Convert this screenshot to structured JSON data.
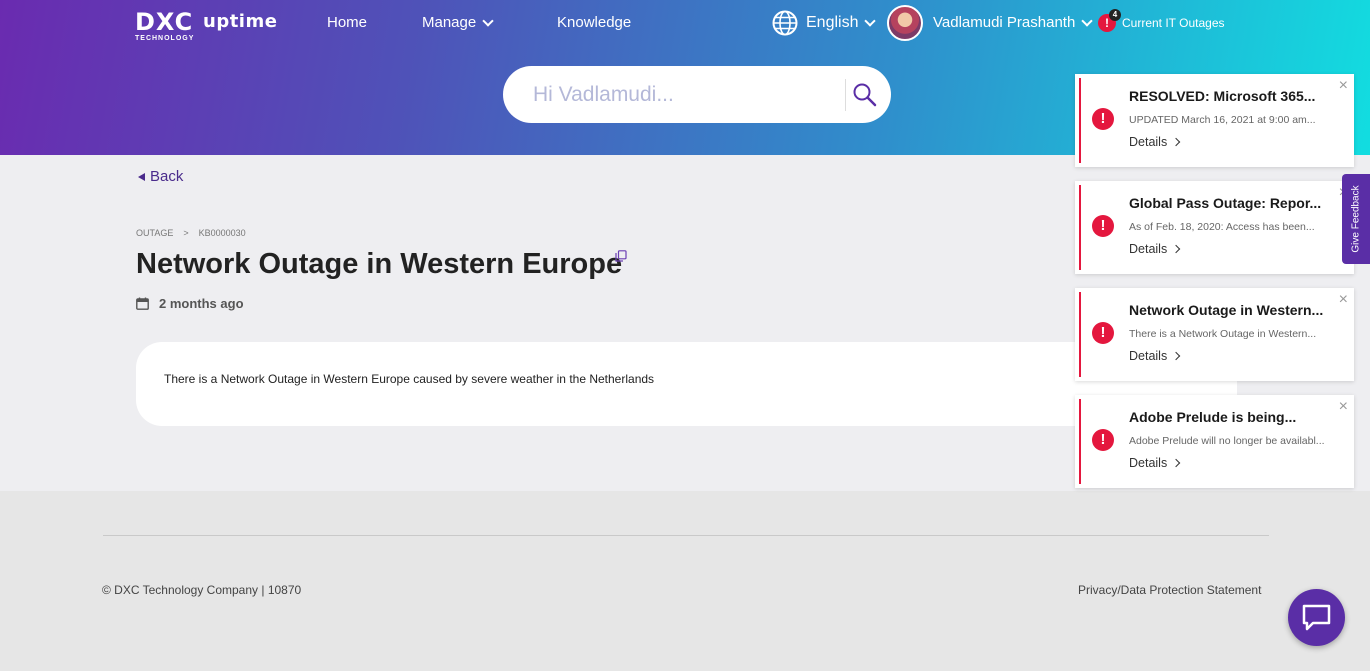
{
  "header": {
    "logo_main": "DXC",
    "logo_sub": "TECHNOLOGY",
    "product": "uptime",
    "nav": {
      "home": "Home",
      "manage": "Manage",
      "knowledge": "Knowledge"
    },
    "language": "English",
    "user_name": "Vadlamudi Prashanth",
    "outage_count": "4",
    "outage_alert_symbol": "!",
    "outage_link": "Current IT Outages"
  },
  "search": {
    "placeholder": "Hi Vadlamudi..."
  },
  "article": {
    "back_label": "Back",
    "breadcrumb": [
      "OUTAGE",
      ">",
      "KB0000030"
    ],
    "title": "Network Outage in Western Europe",
    "date": "2 months ago",
    "body": "There is a Network Outage in Western Europe caused by severe weather in the Netherlands"
  },
  "notifications": [
    {
      "title": "RESOLVED: Microsoft 365...",
      "body": "UPDATED March 16, 2021 at 9:00 am...",
      "details": "Details"
    },
    {
      "title": "Global Pass Outage: Repor...",
      "body": "As of Feb. 18, 2020: Access has been...",
      "details": "Details"
    },
    {
      "title": "Network Outage in Western...",
      "body": "There is a Network Outage in Western...",
      "details": "Details"
    },
    {
      "title": "Adobe Prelude is being...",
      "body": "Adobe Prelude will no longer be availabl...",
      "details": "Details"
    }
  ],
  "notification_icon": "!",
  "feedback_label": "Give Feedback",
  "footer": {
    "copyright": "© DXC Technology Company | 10870",
    "privacy": "Privacy/Data Protection Statement"
  },
  "colors": {
    "brand_purple": "#5a2ea6",
    "alert_red": "#e4173e",
    "gradient_start": "#6a2bb0",
    "gradient_end": "#12dde0"
  }
}
